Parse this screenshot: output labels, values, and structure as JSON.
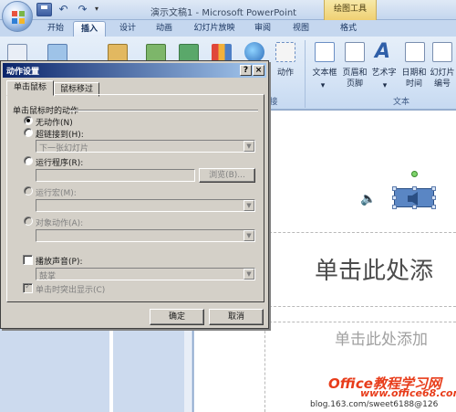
{
  "window": {
    "title": "演示文稿1 - Microsoft PowerPoint",
    "context_tools": "绘图工具"
  },
  "quick_access": {
    "undo": "↶",
    "redo": "↷",
    "more": "▾"
  },
  "tabs": [
    {
      "label": "开始"
    },
    {
      "label": "插入"
    },
    {
      "label": "设计"
    },
    {
      "label": "动画"
    },
    {
      "label": "幻灯片放映"
    },
    {
      "label": "审阅"
    },
    {
      "label": "视图"
    },
    {
      "label": "格式"
    }
  ],
  "ribbon": {
    "action_label": "动作",
    "links_group_fragment": "接",
    "text_group": "文本",
    "textbox_label": "文本框",
    "header_footer_label": "页眉和\n页脚",
    "wordart_label": "艺术字",
    "datetime_label": "日期和\n时间",
    "slide_number_label": "幻灯片\n编号",
    "dropdown_arrow": "▾"
  },
  "slide": {
    "title_placeholder": "单击此处添",
    "subtitle_placeholder": "单击此处添加",
    "sound_icon": "🔈"
  },
  "watermark": {
    "brand": "Office教程学习网",
    "url": "www.office68.com",
    "blog": "blog.163.com/sweet6188@126"
  },
  "dialog": {
    "title": "动作设置",
    "help_btn": "?",
    "close_btn": "×",
    "tabs": [
      "单击鼠标",
      "鼠标移过"
    ],
    "section_title": "单击鼠标时的动作",
    "options": {
      "none": "无动作(N)",
      "hyperlink": "超链接到(H):",
      "run_program": "运行程序(R):",
      "run_macro": "运行宏(M):",
      "object_action": "对象动作(A):"
    },
    "hyperlink_value": "下一张幻灯片",
    "browse_btn": "浏览(B)...",
    "play_sound": "播放声音(P):",
    "sound_value": "鼓掌",
    "highlight_click": "单击时突出显示(C)",
    "ok": "确定",
    "cancel": "取消",
    "combo_arrow": "▼"
  }
}
